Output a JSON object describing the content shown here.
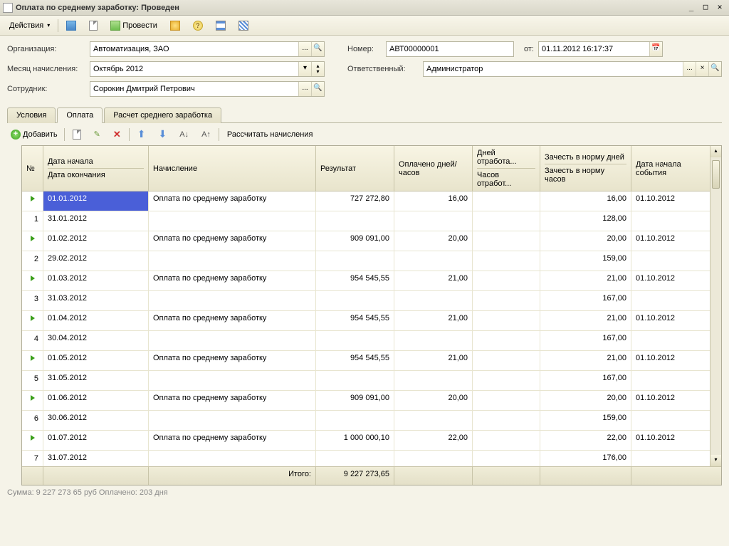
{
  "window": {
    "title": "Оплата по среднему заработку: Проведен"
  },
  "toolbar": {
    "actions": "Действия",
    "post": "Провести"
  },
  "form": {
    "org_label": "Организация:",
    "org_value": "Автоматизация, ЗАО",
    "number_label": "Номер:",
    "number_value": "АВТ00000001",
    "from_label": "от:",
    "from_value": "01.11.2012 16:17:37",
    "month_label": "Месяц начисления:",
    "month_value": "Октябрь 2012",
    "resp_label": "Ответственный:",
    "resp_value": "Администратор",
    "emp_label": "Сотрудник:",
    "emp_value": "Сорокин Дмитрий Петрович"
  },
  "tabs": {
    "t0": "Условия",
    "t1": "Оплата",
    "t2": "Расчет среднего заработка"
  },
  "subtoolbar": {
    "add": "Добавить",
    "recalc": "Рассчитать начисления"
  },
  "headers": {
    "n": "№",
    "date_start": "Дата начала",
    "date_end": "Дата окончания",
    "calc": "Начисление",
    "result": "Результат",
    "paid": "Оплачено дней/часов",
    "days_worked": "Дней отработа...",
    "hours_worked": "Часов отработ...",
    "norm_days": "Зачесть в норму дней",
    "norm_hours": "Зачесть в норму часов",
    "event_date": "Дата начала события"
  },
  "calc_name": "Оплата по среднему заработку",
  "rows": [
    {
      "n": "1",
      "ds": "01.01.2012",
      "de": "31.01.2012",
      "res": "727 272,80",
      "paid": "16,00",
      "nd": "16,00",
      "nh": "128,00",
      "ev": "01.10.2012"
    },
    {
      "n": "2",
      "ds": "01.02.2012",
      "de": "29.02.2012",
      "res": "909 091,00",
      "paid": "20,00",
      "nd": "20,00",
      "nh": "159,00",
      "ev": "01.10.2012"
    },
    {
      "n": "3",
      "ds": "01.03.2012",
      "de": "31.03.2012",
      "res": "954 545,55",
      "paid": "21,00",
      "nd": "21,00",
      "nh": "167,00",
      "ev": "01.10.2012"
    },
    {
      "n": "4",
      "ds": "01.04.2012",
      "de": "30.04.2012",
      "res": "954 545,55",
      "paid": "21,00",
      "nd": "21,00",
      "nh": "167,00",
      "ev": "01.10.2012"
    },
    {
      "n": "5",
      "ds": "01.05.2012",
      "de": "31.05.2012",
      "res": "954 545,55",
      "paid": "21,00",
      "nd": "21,00",
      "nh": "167,00",
      "ev": "01.10.2012"
    },
    {
      "n": "6",
      "ds": "01.06.2012",
      "de": "30.06.2012",
      "res": "909 091,00",
      "paid": "20,00",
      "nd": "20,00",
      "nh": "159,00",
      "ev": "01.10.2012"
    },
    {
      "n": "7",
      "ds": "01.07.2012",
      "de": "31.07.2012",
      "res": "1 000 000,10",
      "paid": "22,00",
      "nd": "22,00",
      "nh": "176,00",
      "ev": "01.10.2012"
    }
  ],
  "footer": {
    "total_label": "Итого:",
    "total_value": "9 227 273,65"
  },
  "status": "Сумма: 9 227 273 65 руб  Оплачено: 203 дня"
}
